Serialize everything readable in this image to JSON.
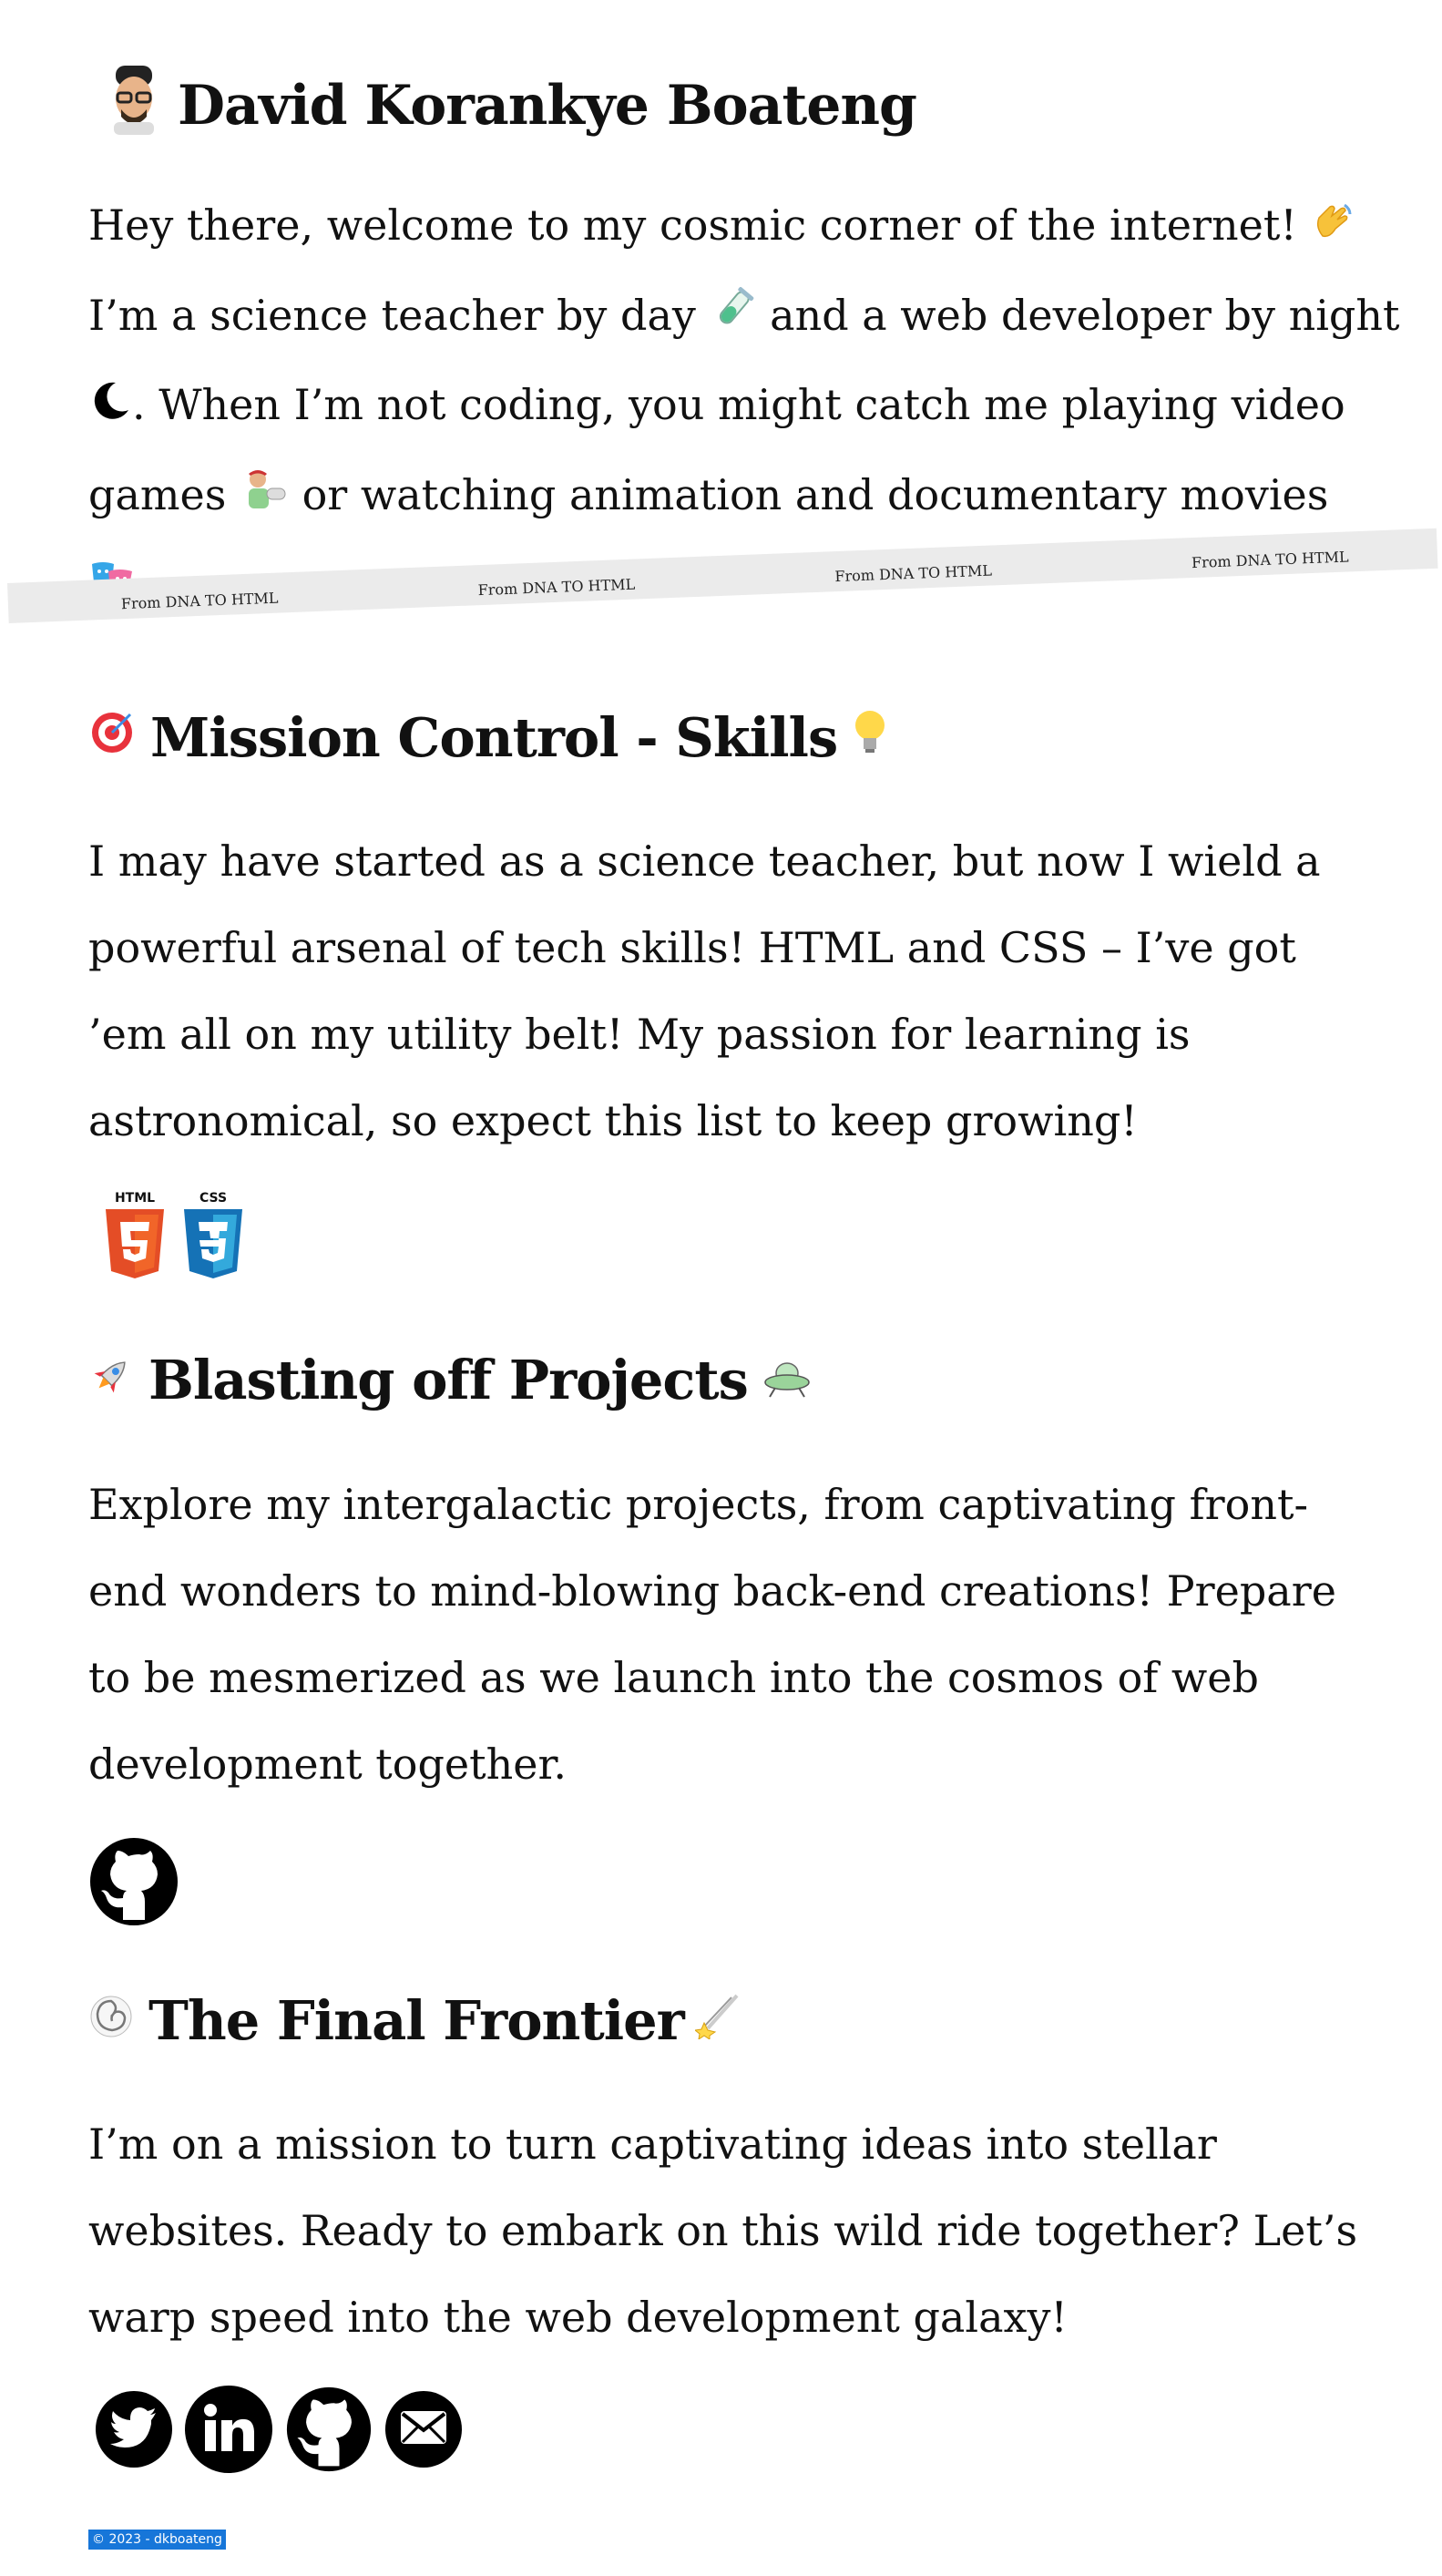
{
  "header": {
    "name": "David Korankye Boateng",
    "avatar_icon": "developer-avatar-icon"
  },
  "intro": {
    "line1": "Hey there, welcome to my cosmic corner of the internet!",
    "line2a": "I’m a science teacher by day",
    "line2b": "and a web developer by night",
    "line3": ". When I’m not coding, you might catch me playing video",
    "line4a": "games",
    "line4b": "or watching animation and documentary movies",
    "line5": "."
  },
  "ribbon": {
    "texts": [
      "From DNA TO HTML",
      "From DNA TO HTML",
      "From DNA TO HTML",
      "From DNA TO HTML"
    ]
  },
  "skills": {
    "title": "Mission Control - Skills",
    "body": "I may have started as a science teacher, but now I wield a powerful arsenal of tech skills! HTML and CSS – I’ve got ’em all on my utility belt! My passion for learning is astronomical, so expect this list to keep growing!",
    "icons": [
      "html5-icon",
      "css3-icon"
    ]
  },
  "projects": {
    "title": "Blasting off Projects",
    "body": "Explore my intergalactic projects, from captivating front-end wonders to mind-blowing back-end creations! Prepare to be mesmerized as we launch into the cosmos of web development together.",
    "icons": [
      "github-icon"
    ]
  },
  "frontier": {
    "title": "The Final Frontier",
    "body": "I’m on a mission to turn captivating ideas into stellar websites. Ready to embark on this wild ride together? Let’s warp speed into the web development galaxy!",
    "icons": [
      "twitter-icon",
      "linkedin-icon",
      "github-icon",
      "email-icon"
    ]
  },
  "footer": {
    "text": "© 2023 - dkboateng"
  },
  "colors": {
    "background": "#ffffff",
    "text": "#111111",
    "ribbon": "#ebebeb",
    "footer_bg": "#1776d9",
    "html5": "#e44d26",
    "css3": "#1572b6"
  }
}
